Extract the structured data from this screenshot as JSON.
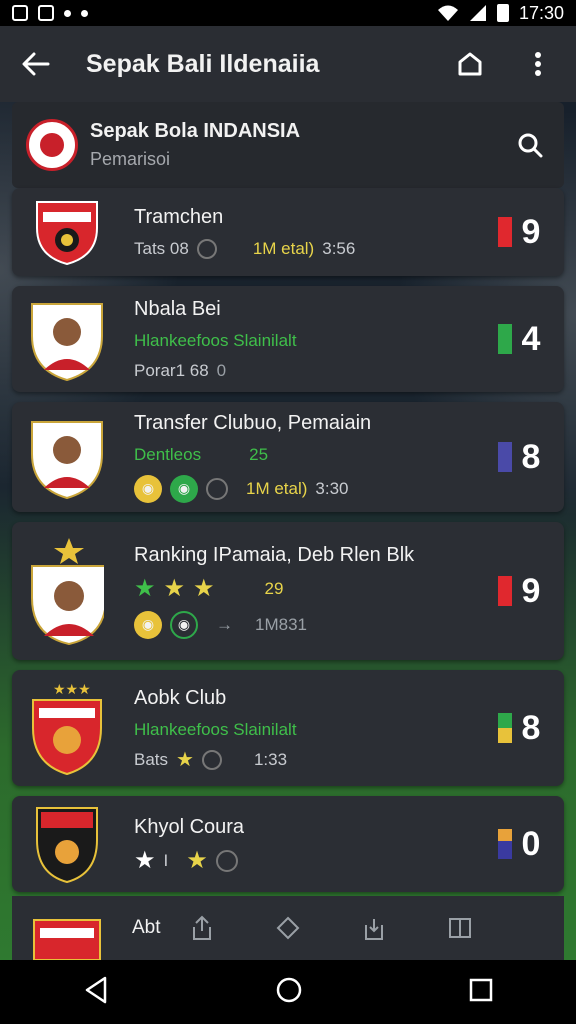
{
  "status": {
    "time": "17:30"
  },
  "appbar": {
    "title": "Sepak Bali Ildenaiia"
  },
  "league": {
    "name": "Sepak Bola INDANSIA",
    "sub": "Pemarisoi"
  },
  "items": [
    {
      "title": "Tramchen",
      "line1": {
        "a": "Tats 08",
        "b": "1M etal)",
        "c": "3:56"
      },
      "score": "9",
      "bar_color": "#e0282e"
    },
    {
      "title": "Nbala Bei",
      "line1": {
        "a": "Hlankeefoos Slainilalt"
      },
      "line2": {
        "a": "Porar1 68",
        "b": "0"
      },
      "score": "4",
      "bar_color": "#2ea84a"
    },
    {
      "title": "Transfer Clubuo, Pemaiain",
      "line1": {
        "a": "Dentleos",
        "b": "25"
      },
      "line2": {
        "b": "1M etal)",
        "c": "3:30"
      },
      "score": "8",
      "bar_color": "#4a4aa8"
    },
    {
      "title": "Ranking IPamaia, Deb Rlen Blk",
      "line1": {
        "b": "29"
      },
      "line2": {
        "c": "1M831"
      },
      "score": "9",
      "bar_color": "#e0282e"
    },
    {
      "title": "Aobk Club",
      "line1": {
        "a": "Hlankeefoos Slainilalt"
      },
      "line2": {
        "a": "Bats",
        "c": "1:33"
      },
      "score": "8",
      "bar_color": "#e8c23a"
    },
    {
      "title": "Khyol Coura",
      "line1": {
        "a": "I"
      },
      "score": "0",
      "bar_color": "#3a3aa0"
    }
  ],
  "toolbar": {
    "label": "Abt"
  }
}
